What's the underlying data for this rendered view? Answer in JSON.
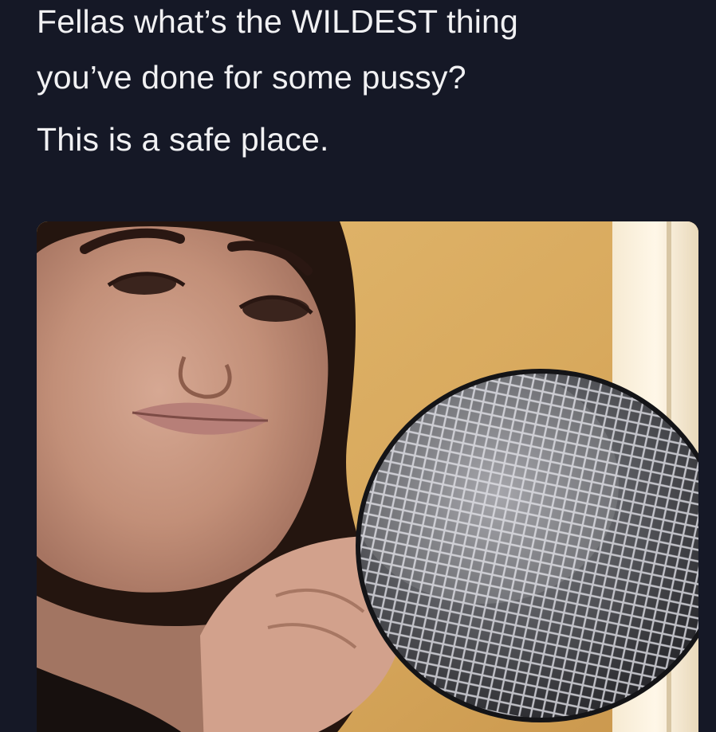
{
  "post": {
    "line1": "Fellas what’s the WILDEST thing",
    "line2": "you’ve done for some pussy?",
    "line3": "This is a safe place."
  },
  "media": {
    "subject": "woman holding microphone toward camera",
    "icon": "photo"
  },
  "colors": {
    "background": "#151826",
    "text": "#f1f1f3",
    "wall": "#d9ac62"
  }
}
